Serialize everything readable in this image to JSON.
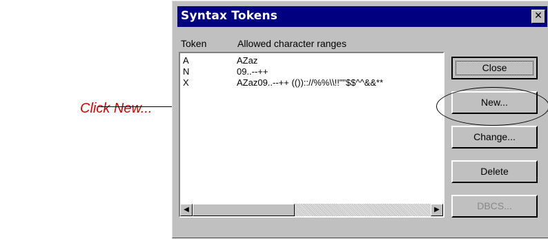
{
  "callout": {
    "text": "Click New..."
  },
  "window": {
    "title": "Syntax Tokens",
    "close_glyph": "✕"
  },
  "list": {
    "headers": {
      "token": "Token",
      "ranges": "Allowed character ranges"
    },
    "rows": [
      {
        "token": "A",
        "ranges": "AZaz"
      },
      {
        "token": "N",
        "ranges": "09..--++"
      },
      {
        "token": "X",
        "ranges": "AZaz09..--++  (()):://%%\\\\!!\"\"$$^^&&**"
      }
    ]
  },
  "buttons": {
    "close": "Close",
    "new": "New...",
    "change": "Change...",
    "delete": "Delete",
    "dbcs": "DBCS..."
  },
  "scrollbar": {
    "left_arrow": "◀",
    "right_arrow": "▶"
  }
}
